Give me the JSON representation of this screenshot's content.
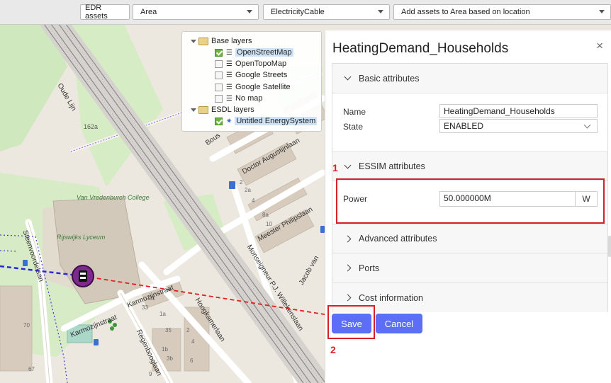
{
  "toolbar": {
    "edr_assets": "EDR assets",
    "area_select": "Area",
    "asset_select": "ElectricityCable",
    "add_assets_select": "Add assets to Area based on location"
  },
  "layers": {
    "base_title": "Base layers",
    "base_items": [
      {
        "label": "OpenStreetMap",
        "checked": true
      },
      {
        "label": "OpenTopoMap",
        "checked": false
      },
      {
        "label": "Google Streets",
        "checked": false
      },
      {
        "label": "Google Satellite",
        "checked": false
      },
      {
        "label": "No map",
        "checked": false
      }
    ],
    "esdl_title": "ESDL layers",
    "esdl_items": [
      {
        "label": "Untitled EnergySystem",
        "checked": true
      }
    ]
  },
  "map_labels": {
    "college": "Van Vredenburch College",
    "lyceum": "Rijswijks Lyceum",
    "street_1": "Doctor Augustijnlaan",
    "street_2": "Meester Philipslaan",
    "street_3": "Monseigneur P.J. Willekenslaan",
    "street_4": "Steenvoordelaan",
    "street_5": "Karmozijnstraat",
    "street_6": "Karmozijnstraat",
    "street_7": "Hoogkamerlaan",
    "street_8": "Regenbooglaan",
    "street_9": "Jacob van",
    "street_10": "Bous",
    "street_11": "Oude Lijn",
    "house_162a": "162a"
  },
  "panel": {
    "title": "HeatingDemand_Households",
    "close": "×",
    "basic_title": "Basic attributes",
    "name_label": "Name",
    "name_value": "HeatingDemand_Households",
    "state_label": "State",
    "state_value": "ENABLED",
    "essim_title": "ESSIM attributes",
    "power_label": "Power",
    "power_value": "50.000000M",
    "power_unit": "W",
    "advanced_title": "Advanced attributes",
    "ports_title": "Ports",
    "cost_title": "Cost information",
    "save": "Save",
    "cancel": "Cancel"
  },
  "annotations": {
    "step1": "1",
    "step2": "2"
  },
  "colors": {
    "accent": "#5b6ef5",
    "highlight_red": "#d6202a",
    "map_green": "#c8e6b0",
    "railway": "#7a7a7a"
  }
}
